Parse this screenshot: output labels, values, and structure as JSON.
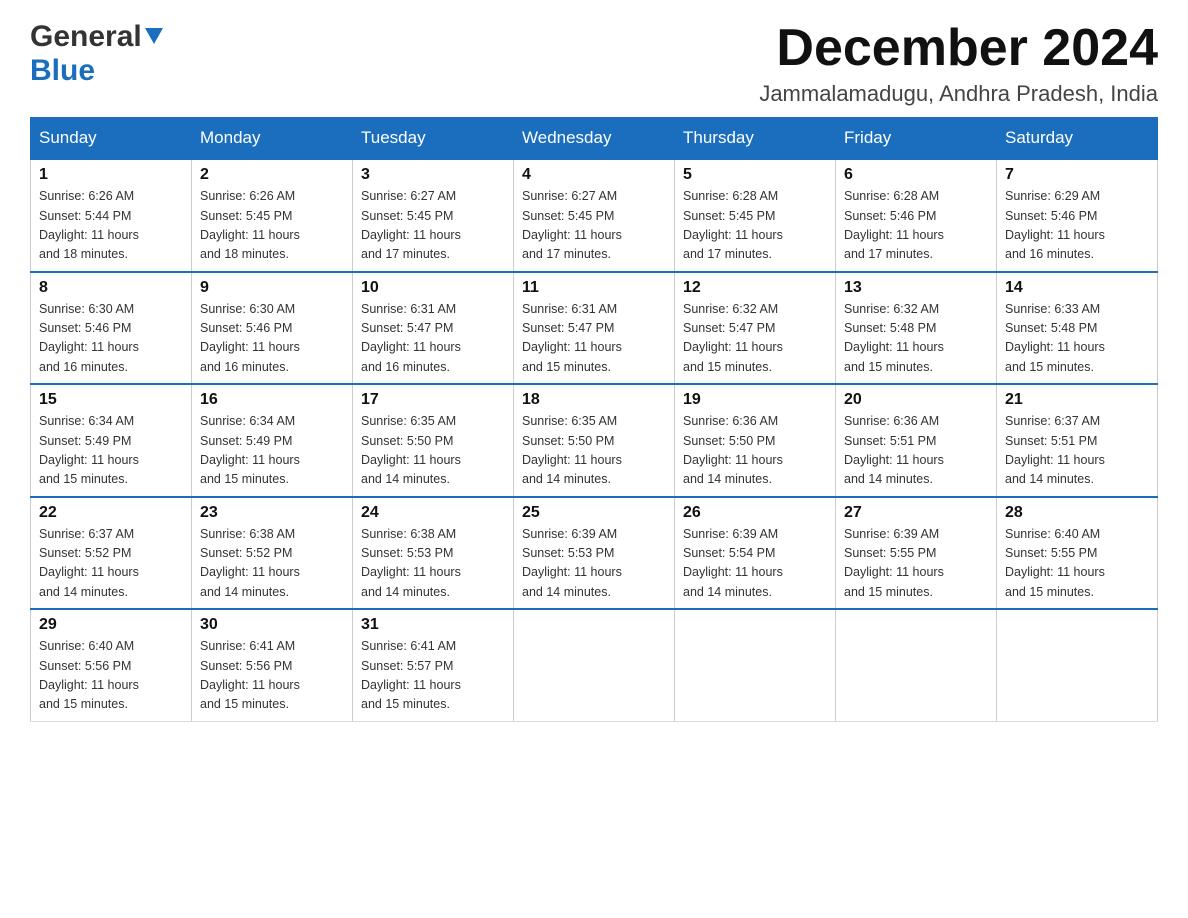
{
  "header": {
    "logo_general": "General",
    "logo_blue": "Blue",
    "month_title": "December 2024",
    "location": "Jammalamadugu, Andhra Pradesh, India"
  },
  "days_of_week": [
    "Sunday",
    "Monday",
    "Tuesday",
    "Wednesday",
    "Thursday",
    "Friday",
    "Saturday"
  ],
  "weeks": [
    [
      {
        "day": "1",
        "sunrise": "6:26 AM",
        "sunset": "5:44 PM",
        "daylight": "11 hours and 18 minutes."
      },
      {
        "day": "2",
        "sunrise": "6:26 AM",
        "sunset": "5:45 PM",
        "daylight": "11 hours and 18 minutes."
      },
      {
        "day": "3",
        "sunrise": "6:27 AM",
        "sunset": "5:45 PM",
        "daylight": "11 hours and 17 minutes."
      },
      {
        "day": "4",
        "sunrise": "6:27 AM",
        "sunset": "5:45 PM",
        "daylight": "11 hours and 17 minutes."
      },
      {
        "day": "5",
        "sunrise": "6:28 AM",
        "sunset": "5:45 PM",
        "daylight": "11 hours and 17 minutes."
      },
      {
        "day": "6",
        "sunrise": "6:28 AM",
        "sunset": "5:46 PM",
        "daylight": "11 hours and 17 minutes."
      },
      {
        "day": "7",
        "sunrise": "6:29 AM",
        "sunset": "5:46 PM",
        "daylight": "11 hours and 16 minutes."
      }
    ],
    [
      {
        "day": "8",
        "sunrise": "6:30 AM",
        "sunset": "5:46 PM",
        "daylight": "11 hours and 16 minutes."
      },
      {
        "day": "9",
        "sunrise": "6:30 AM",
        "sunset": "5:46 PM",
        "daylight": "11 hours and 16 minutes."
      },
      {
        "day": "10",
        "sunrise": "6:31 AM",
        "sunset": "5:47 PM",
        "daylight": "11 hours and 16 minutes."
      },
      {
        "day": "11",
        "sunrise": "6:31 AM",
        "sunset": "5:47 PM",
        "daylight": "11 hours and 15 minutes."
      },
      {
        "day": "12",
        "sunrise": "6:32 AM",
        "sunset": "5:47 PM",
        "daylight": "11 hours and 15 minutes."
      },
      {
        "day": "13",
        "sunrise": "6:32 AM",
        "sunset": "5:48 PM",
        "daylight": "11 hours and 15 minutes."
      },
      {
        "day": "14",
        "sunrise": "6:33 AM",
        "sunset": "5:48 PM",
        "daylight": "11 hours and 15 minutes."
      }
    ],
    [
      {
        "day": "15",
        "sunrise": "6:34 AM",
        "sunset": "5:49 PM",
        "daylight": "11 hours and 15 minutes."
      },
      {
        "day": "16",
        "sunrise": "6:34 AM",
        "sunset": "5:49 PM",
        "daylight": "11 hours and 15 minutes."
      },
      {
        "day": "17",
        "sunrise": "6:35 AM",
        "sunset": "5:50 PM",
        "daylight": "11 hours and 14 minutes."
      },
      {
        "day": "18",
        "sunrise": "6:35 AM",
        "sunset": "5:50 PM",
        "daylight": "11 hours and 14 minutes."
      },
      {
        "day": "19",
        "sunrise": "6:36 AM",
        "sunset": "5:50 PM",
        "daylight": "11 hours and 14 minutes."
      },
      {
        "day": "20",
        "sunrise": "6:36 AM",
        "sunset": "5:51 PM",
        "daylight": "11 hours and 14 minutes."
      },
      {
        "day": "21",
        "sunrise": "6:37 AM",
        "sunset": "5:51 PM",
        "daylight": "11 hours and 14 minutes."
      }
    ],
    [
      {
        "day": "22",
        "sunrise": "6:37 AM",
        "sunset": "5:52 PM",
        "daylight": "11 hours and 14 minutes."
      },
      {
        "day": "23",
        "sunrise": "6:38 AM",
        "sunset": "5:52 PM",
        "daylight": "11 hours and 14 minutes."
      },
      {
        "day": "24",
        "sunrise": "6:38 AM",
        "sunset": "5:53 PM",
        "daylight": "11 hours and 14 minutes."
      },
      {
        "day": "25",
        "sunrise": "6:39 AM",
        "sunset": "5:53 PM",
        "daylight": "11 hours and 14 minutes."
      },
      {
        "day": "26",
        "sunrise": "6:39 AM",
        "sunset": "5:54 PM",
        "daylight": "11 hours and 14 minutes."
      },
      {
        "day": "27",
        "sunrise": "6:39 AM",
        "sunset": "5:55 PM",
        "daylight": "11 hours and 15 minutes."
      },
      {
        "day": "28",
        "sunrise": "6:40 AM",
        "sunset": "5:55 PM",
        "daylight": "11 hours and 15 minutes."
      }
    ],
    [
      {
        "day": "29",
        "sunrise": "6:40 AM",
        "sunset": "5:56 PM",
        "daylight": "11 hours and 15 minutes."
      },
      {
        "day": "30",
        "sunrise": "6:41 AM",
        "sunset": "5:56 PM",
        "daylight": "11 hours and 15 minutes."
      },
      {
        "day": "31",
        "sunrise": "6:41 AM",
        "sunset": "5:57 PM",
        "daylight": "11 hours and 15 minutes."
      },
      null,
      null,
      null,
      null
    ]
  ],
  "labels": {
    "sunrise": "Sunrise:",
    "sunset": "Sunset:",
    "daylight": "Daylight:"
  }
}
